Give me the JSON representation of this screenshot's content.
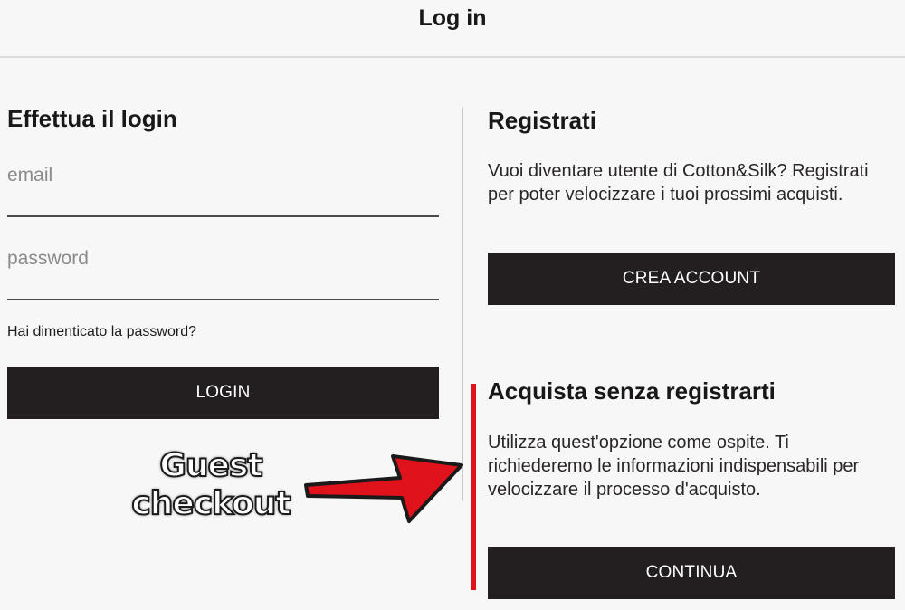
{
  "header": {
    "title": "Log in"
  },
  "login": {
    "title": "Effettua il login",
    "email_placeholder": "email",
    "password_placeholder": "password",
    "forgot_label": "Hai dimenticato la password?",
    "login_button": "LOGIN"
  },
  "register": {
    "title": "Registrati",
    "description": "Vuoi diventare utente di Cotton&Silk? Registrati per poter velocizzare i tuoi prossimi acquisti.",
    "create_button": "CREA ACCOUNT"
  },
  "guest": {
    "title": "Acquista senza registrarti",
    "description": "Utilizza quest'opzione come ospite. Ti richiederemo le informazioni indispensabili per velocizzare il processo d'acquisto.",
    "continue_button": "CONTINUA"
  },
  "annotation": {
    "line1": "Guest",
    "line2": "checkout",
    "accent_color": "#e0121b"
  },
  "colors": {
    "button_bg": "#231f20",
    "button_text": "#ffffff",
    "page_bg": "#f7f7f7"
  }
}
